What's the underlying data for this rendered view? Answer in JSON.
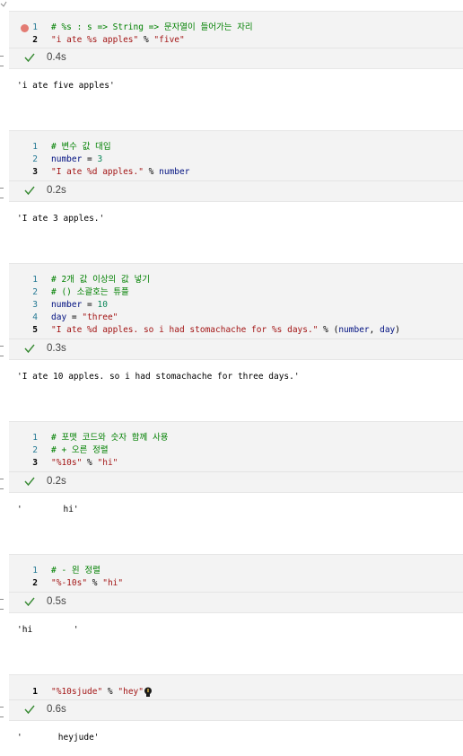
{
  "cells": [
    {
      "lines": [
        [
          {
            "t": "# %s : s => String => 문자열이 들어가는 자리",
            "c": "cmt"
          }
        ],
        [
          {
            "t": "\"i ate %s apples\"",
            "c": "str"
          },
          {
            "t": " % ",
            "c": "op"
          },
          {
            "t": "\"five\"",
            "c": "str"
          }
        ]
      ],
      "time": "0.4s",
      "output": "'i ate five apples'"
    },
    {
      "lines": [
        [
          {
            "t": "# 변수 값 대입",
            "c": "cmt"
          }
        ],
        [
          {
            "t": "number",
            "c": "var"
          },
          {
            "t": " = ",
            "c": "op"
          },
          {
            "t": "3",
            "c": "num"
          }
        ],
        [
          {
            "t": "\"I ate %d apples.\"",
            "c": "str"
          },
          {
            "t": " % ",
            "c": "op"
          },
          {
            "t": "number",
            "c": "var"
          }
        ]
      ],
      "time": "0.2s",
      "output": "'I ate 3 apples.'"
    },
    {
      "lines": [
        [
          {
            "t": "# 2개 값 이상의 값 넣기",
            "c": "cmt"
          }
        ],
        [
          {
            "t": "# () 소괄호는 튜플",
            "c": "cmt"
          }
        ],
        [
          {
            "t": "number",
            "c": "var"
          },
          {
            "t": " = ",
            "c": "op"
          },
          {
            "t": "10",
            "c": "num"
          }
        ],
        [
          {
            "t": "day",
            "c": "var"
          },
          {
            "t": " = ",
            "c": "op"
          },
          {
            "t": "\"three\"",
            "c": "str"
          }
        ],
        [
          {
            "t": "\"I ate %d apples. so i had stomachache for %s days.\"",
            "c": "str"
          },
          {
            "t": " % (",
            "c": "op"
          },
          {
            "t": "number",
            "c": "var"
          },
          {
            "t": ", ",
            "c": "op"
          },
          {
            "t": "day",
            "c": "var"
          },
          {
            "t": ")",
            "c": "op"
          }
        ]
      ],
      "time": "0.3s",
      "output": "'I ate 10 apples. so i had stomachache for three days.'"
    },
    {
      "lines": [
        [
          {
            "t": "# 포맷 코드와 숫자 함께 사용",
            "c": "cmt"
          }
        ],
        [
          {
            "t": "# + 오른 정렬",
            "c": "cmt"
          }
        ],
        [
          {
            "t": "\"%10s\"",
            "c": "str"
          },
          {
            "t": " % ",
            "c": "op"
          },
          {
            "t": "\"hi\"",
            "c": "str"
          }
        ]
      ],
      "time": "0.2s",
      "output": "'        hi'"
    },
    {
      "lines": [
        [
          {
            "t": "# - 왼 정렬",
            "c": "cmt"
          }
        ],
        [
          {
            "t": "\"%-10s\"",
            "c": "str"
          },
          {
            "t": " % ",
            "c": "op"
          },
          {
            "t": "\"hi\"",
            "c": "str"
          }
        ]
      ],
      "time": "0.5s",
      "output": "'hi        '"
    },
    {
      "lines": [
        [
          {
            "t": "\"%10sjude\"",
            "c": "str"
          },
          {
            "t": " % ",
            "c": "op"
          },
          {
            "t": "\"hey\"",
            "c": "str"
          }
        ]
      ],
      "time": "0.6s",
      "output": "'       heyjude'"
    }
  ],
  "icons": {
    "success": "checkmark-icon",
    "unsaved": "modified-dot-icon",
    "hint": "lightbulb-icon"
  },
  "colors": {
    "comment": "#008000",
    "string": "#a31515",
    "variable": "#001080",
    "number": "#098658",
    "check": "#388a34",
    "dot": "#e37b73"
  }
}
